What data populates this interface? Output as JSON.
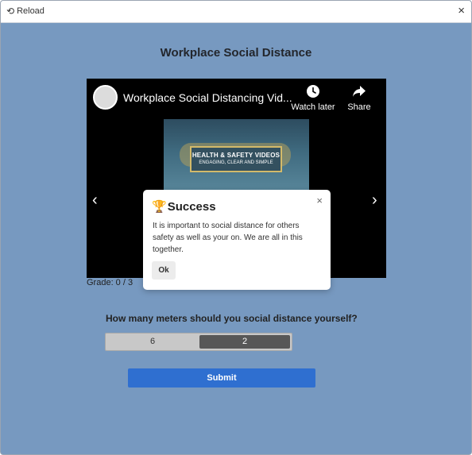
{
  "titlebar": {
    "reload_icon": "reload-icon",
    "reload_label": "Reload",
    "close_glyph": "×"
  },
  "page": {
    "title": "Workplace Social Distance"
  },
  "video": {
    "title": "Workplace Social Distancing Vid...",
    "watch_later_label": "Watch later",
    "share_label": "Share",
    "thumbnail_line1": "HEALTH & SAFETY VIDEOS",
    "thumbnail_line2": "ENGAGING, CLEAR AND SIMPLE",
    "prev_glyph": "‹",
    "next_glyph": "›"
  },
  "grade": {
    "text": "Grade: 0 / 3"
  },
  "modal": {
    "trophy": "🏆",
    "title": "Success",
    "body": "It is important to social distance for others safety as well as your on. We are all in this together.",
    "ok_label": "Ok",
    "close_glyph": "×"
  },
  "quiz": {
    "question": "How many meters should you social distance yourself?",
    "options": [
      "6",
      "2"
    ],
    "selected": "2",
    "submit_label": "Submit"
  },
  "colors": {
    "background": "#7799c0",
    "submit": "#2f6fd0",
    "selected_option": "#575757"
  }
}
